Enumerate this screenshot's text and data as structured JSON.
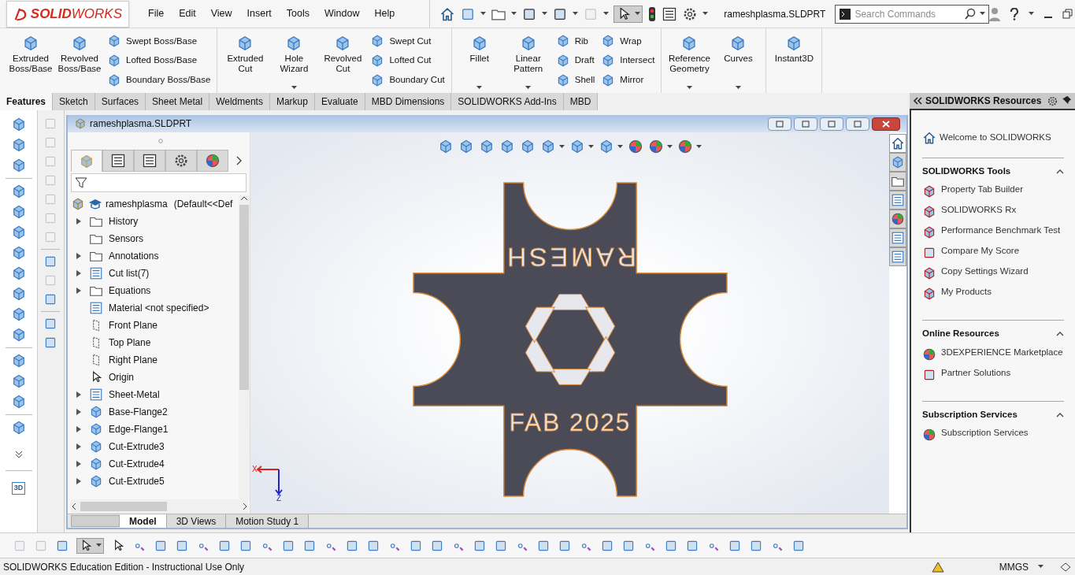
{
  "logo": {
    "text": "**SOLID**WORKS"
  },
  "menus": [
    "File",
    "Edit",
    "View",
    "Insert",
    "Tools",
    "Window",
    "Help"
  ],
  "document_name": "rameshplasma.SLDPRT",
  "search": {
    "placeholder": "Search Commands"
  },
  "ribbon": [
    {
      "items": [
        {
          "kind": "large",
          "label": "Extruded Boss/Base",
          "dropdown": false
        },
        {
          "kind": "large",
          "label": "Revolved Boss/Base",
          "dropdown": false
        },
        {
          "kind": "column",
          "items": [
            "Swept Boss/Base",
            "Lofted Boss/Base",
            "Boundary Boss/Base"
          ]
        }
      ]
    },
    {
      "items": [
        {
          "kind": "large",
          "label": "Extruded Cut",
          "dropdown": false
        },
        {
          "kind": "large",
          "label": "Hole Wizard",
          "dropdown": true
        },
        {
          "kind": "large",
          "label": "Revolved Cut",
          "dropdown": false
        },
        {
          "kind": "column",
          "items": [
            "Swept Cut",
            "Lofted Cut",
            "Boundary Cut"
          ]
        }
      ]
    },
    {
      "items": [
        {
          "kind": "large",
          "label": "Fillet",
          "dropdown": true
        },
        {
          "kind": "large",
          "label": "Linear Pattern",
          "dropdown": true
        },
        {
          "kind": "column",
          "items": [
            "Rib",
            "Draft",
            "Shell"
          ]
        },
        {
          "kind": "column",
          "items": [
            "Wrap",
            "Intersect",
            "Mirror"
          ]
        }
      ]
    },
    {
      "items": [
        {
          "kind": "large",
          "label": "Reference Geometry",
          "dropdown": true
        },
        {
          "kind": "large",
          "label": "Curves",
          "dropdown": true
        }
      ]
    },
    {
      "items": [
        {
          "kind": "large",
          "label": "Instant3D",
          "dropdown": false
        }
      ]
    }
  ],
  "command_tabs": [
    {
      "label": "Features",
      "selected": true
    },
    {
      "label": "Sketch",
      "selected": false
    },
    {
      "label": "Surfaces",
      "selected": false
    },
    {
      "label": "Sheet Metal",
      "selected": false
    },
    {
      "label": "Weldments",
      "selected": false
    },
    {
      "label": "Markup",
      "selected": false
    },
    {
      "label": "Evaluate",
      "selected": false
    },
    {
      "label": "MBD Dimensions",
      "selected": false
    },
    {
      "label": "SOLIDWORKS Add-Ins",
      "selected": false
    },
    {
      "label": "MBD",
      "selected": false
    }
  ],
  "instant3d_toggle": {
    "label": "3D"
  },
  "document_window": {
    "title": "rameshplasma.SLDPRT"
  },
  "feature_tree": {
    "root": {
      "name": "rameshplasma",
      "configuration": "(Default<<Def",
      "children": [
        {
          "label": "History",
          "expandable": true
        },
        {
          "label": "Sensors",
          "expandable": false
        },
        {
          "label": "Annotations",
          "expandable": true
        },
        {
          "label": "Cut list(7)",
          "expandable": true
        },
        {
          "label": "Equations",
          "expandable": true
        },
        {
          "label": "Material <not specified>",
          "expandable": false
        },
        {
          "label": "Front Plane",
          "expandable": false
        },
        {
          "label": "Top Plane",
          "expandable": false
        },
        {
          "label": "Right Plane",
          "expandable": false
        },
        {
          "label": "Origin",
          "expandable": false
        },
        {
          "label": "Sheet-Metal",
          "expandable": true
        },
        {
          "label": "Base-Flange2",
          "expandable": true
        },
        {
          "label": "Edge-Flange1",
          "expandable": true
        },
        {
          "label": "Cut-Extrude3",
          "expandable": true
        },
        {
          "label": "Cut-Extrude4",
          "expandable": true
        },
        {
          "label": "Cut-Extrude5",
          "expandable": true
        }
      ]
    }
  },
  "model": {
    "engraving_top": "RAMESH",
    "engraving_bottom": "FAB 2025",
    "triad": [
      "X",
      "Z"
    ]
  },
  "bottom_tabs": [
    {
      "label": "Model",
      "selected": true
    },
    {
      "label": "3D Views",
      "selected": false
    },
    {
      "label": "Motion Study 1",
      "selected": false
    }
  ],
  "resources": {
    "title": "SOLIDWORKS Resources",
    "welcome": "Welcome to SOLIDWORKS",
    "sections": [
      {
        "title": "SOLIDWORKS Tools",
        "expanded": true,
        "items": [
          "Property Tab Builder",
          "SOLIDWORKS Rx",
          "Performance Benchmark Test",
          "Compare My Score",
          "Copy Settings Wizard",
          "My Products"
        ]
      },
      {
        "title": "Online Resources",
        "expanded": true,
        "items": [
          "3DEXPERIENCE Marketplace",
          "Partner Solutions"
        ]
      },
      {
        "title": "Subscription Services",
        "expanded": true,
        "items": [
          "Subscription Services"
        ]
      }
    ]
  },
  "status_bar": {
    "message": "SOLIDWORKS Education Edition - Instructional Use Only",
    "units": "MMGS"
  }
}
